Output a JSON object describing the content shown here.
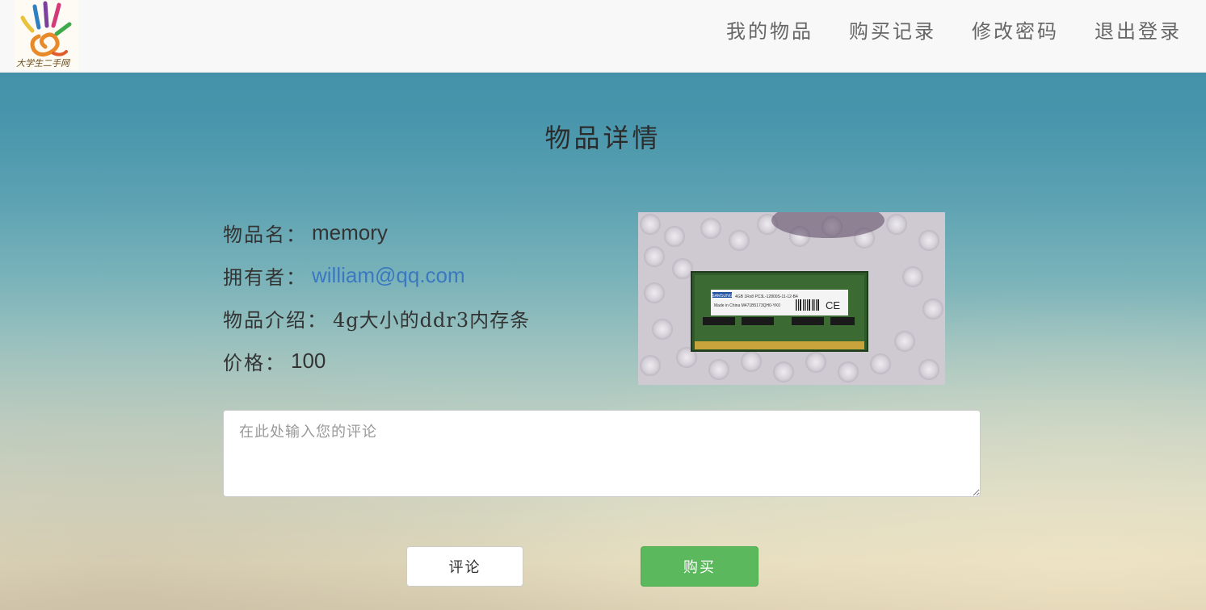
{
  "nav": {
    "logo_text": "大学生二手网",
    "items": [
      {
        "label": "我的物品"
      },
      {
        "label": "购买记录"
      },
      {
        "label": "修改密码"
      },
      {
        "label": "退出登录"
      }
    ]
  },
  "page": {
    "title": "物品详情"
  },
  "item": {
    "name_label": "物品名：",
    "name": "memory",
    "owner_label": "拥有者：",
    "owner": "william@qq.com",
    "desc_label": "物品介绍：",
    "desc": "4g大小的ddr3内存条",
    "price_label": "价格：",
    "price": "100"
  },
  "image": {
    "chip_label_brand": "SAMSUNG",
    "chip_label_line1": "4GB 1Rx8 PC3L-12800S-11-12-B4",
    "chip_label_line2": "Made in China  M471B5173QH0-YK0",
    "chip_label_mark": "CE"
  },
  "comment": {
    "placeholder": "在此处输入您的评论",
    "value": ""
  },
  "buttons": {
    "comment_label": "评论",
    "buy_label": "购买"
  },
  "colors": {
    "navbar_bg": "#f8f8f8",
    "link": "#3a78c0",
    "buy_button": "#5cb85c",
    "text": "#333333"
  }
}
